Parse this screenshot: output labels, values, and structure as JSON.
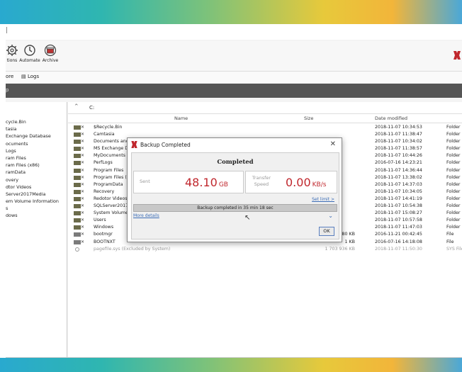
{
  "colors": {
    "accent": "#c0272d",
    "link": "#3a6bb5",
    "darkbar": "#555555"
  },
  "ribbon": {
    "buttons": [
      {
        "label": "tions",
        "icon": "gear-icon"
      },
      {
        "label": "Automate",
        "icon": "clock-icon"
      },
      {
        "label": "Archive",
        "icon": "archive-icon"
      }
    ]
  },
  "tabs": {
    "left": "ore",
    "logs": "Logs"
  },
  "darkbar": {
    "label": "p"
  },
  "tree": [
    "cycle.Bin",
    "tasia",
    "Exchange Database",
    "ocuments",
    "Logs",
    "ram Files",
    "ram Files (x86)",
    "ramData",
    "overy",
    "dtor Videos",
    "Server2017Media",
    "em Volume Information",
    "s",
    "dows"
  ],
  "path": "C:",
  "columns": {
    "name": "Name",
    "size": "Size",
    "date": "Date modified"
  },
  "rows": [
    {
      "name": "$Recycle.Bin",
      "size": "",
      "date": "2018-11-07 10:34:53",
      "type": "Folder",
      "kind": "folder"
    },
    {
      "name": "Camtasia",
      "size": "",
      "date": "2018-11-07 11:38:47",
      "type": "Folder",
      "kind": "folder"
    },
    {
      "name": "Documents and S",
      "size": "",
      "date": "2018-11-07 10:34:02",
      "type": "Folder (",
      "kind": "folder"
    },
    {
      "name": "MS Exchange Dat",
      "size": "",
      "date": "2018-11-07 11:38:57",
      "type": "Folder",
      "kind": "folder"
    },
    {
      "name": "MyDocuments",
      "size": "",
      "date": "2018-11-07 10:44:26",
      "type": "Folder",
      "kind": "folder"
    },
    {
      "name": "PerfLogs",
      "size": "",
      "date": "2016-07-16 14:23:21",
      "type": "Folder",
      "kind": "folder"
    },
    {
      "name": "Program Files",
      "size": "",
      "date": "2018-11-07 14:36:44",
      "type": "Folder",
      "kind": "folder"
    },
    {
      "name": "Program Files (x8",
      "size": "",
      "date": "2018-11-07 13:38:02",
      "type": "Folder",
      "kind": "folder"
    },
    {
      "name": "ProgramData",
      "size": "",
      "date": "2018-11-07 14:37:03",
      "type": "Folder",
      "kind": "folder"
    },
    {
      "name": "Recovery",
      "size": "",
      "date": "2018-11-07 10:34:05",
      "type": "Folder",
      "kind": "folder"
    },
    {
      "name": "Redotor Videos",
      "size": "",
      "date": "2018-11-07 14:41:19",
      "type": "Folder",
      "kind": "folder"
    },
    {
      "name": "SQLServer2017M",
      "size": "",
      "date": "2018-11-07 10:54:38",
      "type": "Folder",
      "kind": "folder"
    },
    {
      "name": "System Volume I",
      "size": "",
      "date": "2018-11-07 15:08:27",
      "type": "Folder",
      "kind": "folder"
    },
    {
      "name": "Users",
      "size": "",
      "date": "2018-11-07 10:57:58",
      "type": "Folder",
      "kind": "folder"
    },
    {
      "name": "Windows",
      "size": "",
      "date": "2018-11-07 11:47:03",
      "type": "Folder",
      "kind": "folder"
    },
    {
      "name": "bootmgr",
      "size": "380 KB",
      "date": "2016-11-21 00:42:45",
      "type": "File",
      "kind": "file"
    },
    {
      "name": "BOOTNXT",
      "size": "1 KB",
      "date": "2016-07-16 14:18:08",
      "type": "File",
      "kind": "file"
    },
    {
      "name": "pagefile.sys (Excluded by System)",
      "size": "1 703 936 KB",
      "date": "2018-11-07 11:50:30",
      "type": "SYS File",
      "kind": "excluded"
    }
  ],
  "dialog": {
    "title": "Backup Completed",
    "heading": "Completed",
    "sent_label": "Sent",
    "sent_value": "48.10",
    "sent_unit": "GB",
    "speed_label": "Transfer Speed",
    "speed_value": "0.00",
    "speed_unit": "KB/s",
    "set_limit": "Set limit >",
    "progress_text": "Backup completed in 35 min 18 sec",
    "progress_fraction": 1.0,
    "more_details": "More details",
    "ok": "OK"
  }
}
